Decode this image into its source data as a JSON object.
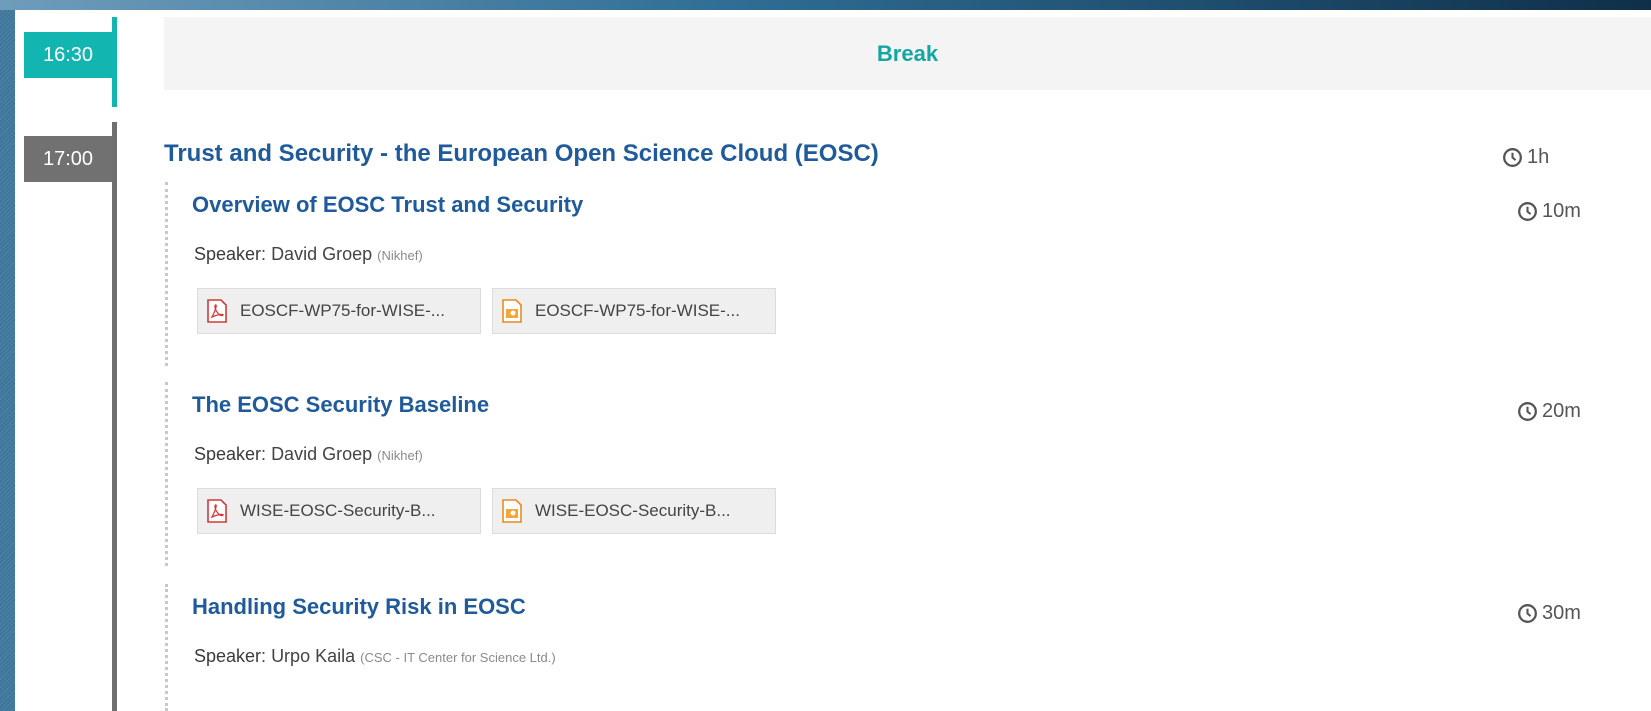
{
  "timeline": {
    "break_time": "16:30",
    "session_time": "17:00"
  },
  "break_label": "Break",
  "session": {
    "title": "Trust and Security - the European Open Science Cloud (EOSC)",
    "duration": "1h",
    "talks": [
      {
        "title": "Overview of EOSC Trust and Security",
        "duration": "10m",
        "speaker_label": "Speaker",
        "speaker_name": "David Groep",
        "affiliation": "(Nikhef)",
        "attachments": [
          {
            "type": "pdf",
            "name": "EOSCF-WP75-for-WISE-..."
          },
          {
            "type": "ppt",
            "name": "EOSCF-WP75-for-WISE-..."
          }
        ]
      },
      {
        "title": "The EOSC Security Baseline",
        "duration": "20m",
        "speaker_label": "Speaker",
        "speaker_name": "David Groep",
        "affiliation": "(Nikhef)",
        "attachments": [
          {
            "type": "pdf",
            "name": "WISE-EOSC-Security-B..."
          },
          {
            "type": "ppt",
            "name": "WISE-EOSC-Security-B..."
          }
        ]
      },
      {
        "title": "Handling Security Risk in EOSC",
        "duration": "30m",
        "speaker_label": "Speaker",
        "speaker_name": "Urpo Kaila",
        "affiliation": "(CSC - IT Center for Science Ltd.)",
        "attachments": []
      }
    ]
  },
  "icons": {
    "clock": "clock-icon",
    "pdf": "pdf-file-icon",
    "ppt": "presentation-file-icon"
  },
  "colors": {
    "accent_teal": "#13b5b1",
    "title_blue": "#1f5a9a",
    "time_grey": "#717171"
  }
}
